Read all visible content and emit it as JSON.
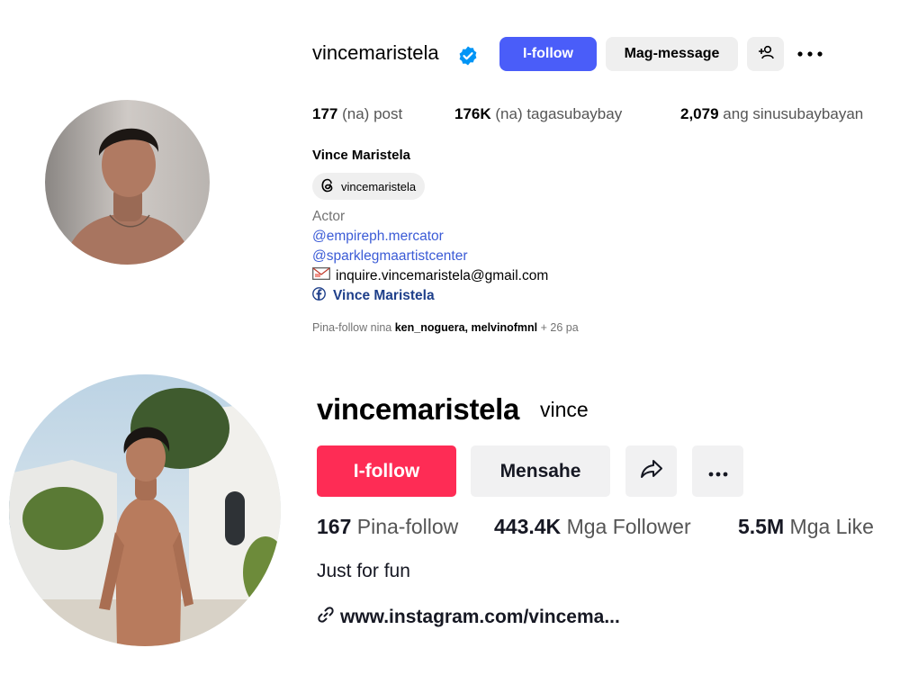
{
  "instagram": {
    "username": "vincemaristela",
    "follow_label": "I-follow",
    "message_label": "Mag-message",
    "stats": {
      "posts_count": "177",
      "posts_label": "(na) post",
      "followers_count": "176K",
      "followers_label": "(na) tagasubaybay",
      "following_count": "2,079",
      "following_label": "ang sinusubaybayan"
    },
    "display_name": "Vince Maristela",
    "threads_handle": "vincemaristela",
    "bio": {
      "category": "Actor",
      "mention_1": "@empireph.mercator",
      "mention_2": "@sparklegmaartistcenter",
      "email": "inquire.vincemaristela@gmail.com",
      "facebook": "Vince Maristela"
    },
    "followed_by": {
      "prefix": "Pina-follow nina",
      "user_1": "ken_noguera",
      "separator": ",",
      "user_2": "melvinofmnl",
      "suffix": "+ 26 pa"
    },
    "colors": {
      "follow": "#4a5df9",
      "verified": "#0095f6"
    }
  },
  "tiktok": {
    "username": "vincemaristela",
    "nickname": "vince",
    "follow_label": "I-follow",
    "message_label": "Mensahe",
    "stats": {
      "following_count": "167",
      "following_label": "Pina-follow",
      "followers_count": "443.4K",
      "followers_label": "Mga Follower",
      "likes_count": "5.5M",
      "likes_label": "Mga Like"
    },
    "bio": "Just for fun",
    "link": "www.instagram.com/vincema...",
    "colors": {
      "follow": "#fe2c55"
    }
  }
}
